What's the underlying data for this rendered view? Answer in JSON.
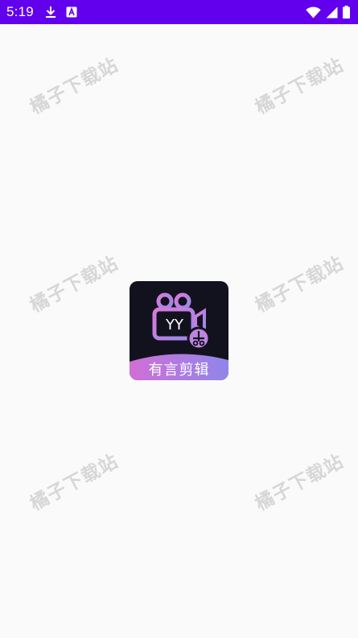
{
  "status_bar": {
    "time": "5:19",
    "background": "#6200ee",
    "left_icons": [
      "download-icon",
      "a-badge-icon"
    ],
    "right_icons": [
      "wifi-icon",
      "signal-icon",
      "battery-icon"
    ]
  },
  "watermark": {
    "text": "橘子下载站"
  },
  "app_logo": {
    "camera_text": "YY",
    "name": "有言剪辑",
    "colors": {
      "background": "#12121e",
      "gradient_start": "#d06fd6",
      "gradient_end": "#8f86ea"
    }
  }
}
